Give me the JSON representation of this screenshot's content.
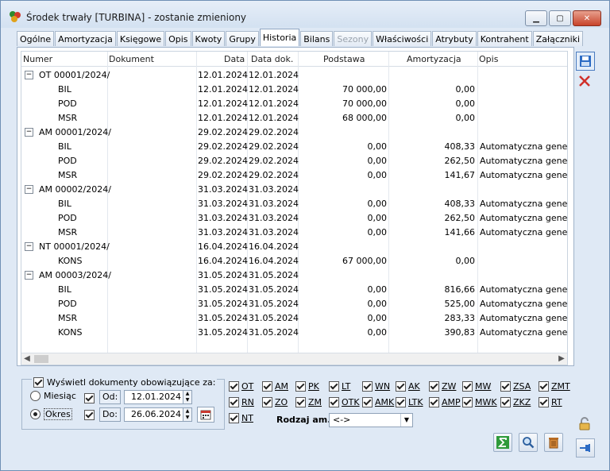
{
  "window": {
    "title": "Środek trwały [TURBINA] - zostanie zmieniony",
    "min_label": "▁",
    "max_label": "▢",
    "close_label": "✕"
  },
  "tabs": [
    {
      "label": "Ogólne"
    },
    {
      "label": "Amortyzacja"
    },
    {
      "label": "Księgowe"
    },
    {
      "label": "Opis"
    },
    {
      "label": "Kwoty"
    },
    {
      "label": "Grupy"
    },
    {
      "label": "Historia"
    },
    {
      "label": "Bilans"
    },
    {
      "label": "Sezony"
    },
    {
      "label": "Właściwości"
    },
    {
      "label": "Atrybuty"
    },
    {
      "label": "Kontrahent"
    },
    {
      "label": "Załączniki"
    }
  ],
  "active_tab": "Historia",
  "grid": {
    "headers": {
      "numer": "Numer",
      "dokument": "Dokument",
      "data": "Data",
      "data_dok": "Data dok.",
      "podstawa": "Podstawa",
      "amortyzacja": "Amortyzacja",
      "opis": "Opis"
    },
    "rows": [
      {
        "group": true,
        "toggle": "−",
        "numer": "OT  00001/2024/",
        "dokument": "",
        "data": "12.01.2024",
        "data_dok": "12.01.2024",
        "podstawa": "",
        "amortyzacja": "",
        "opis": ""
      },
      {
        "group": false,
        "numer": "BIL",
        "dokument": "",
        "data": "12.01.2024",
        "data_dok": "12.01.2024",
        "podstawa": "70 000,00",
        "amortyzacja": "0,00",
        "opis": ""
      },
      {
        "group": false,
        "numer": "POD",
        "dokument": "",
        "data": "12.01.2024",
        "data_dok": "12.01.2024",
        "podstawa": "70 000,00",
        "amortyzacja": "0,00",
        "opis": ""
      },
      {
        "group": false,
        "numer": "MSR",
        "dokument": "",
        "data": "12.01.2024",
        "data_dok": "12.01.2024",
        "podstawa": "68 000,00",
        "amortyzacja": "0,00",
        "opis": ""
      },
      {
        "group": true,
        "toggle": "−",
        "numer": "AM  00001/2024/",
        "dokument": "",
        "data": "29.02.2024",
        "data_dok": "29.02.2024",
        "podstawa": "",
        "amortyzacja": "",
        "opis": ""
      },
      {
        "group": false,
        "numer": "BIL",
        "dokument": "",
        "data": "29.02.2024",
        "data_dok": "29.02.2024",
        "podstawa": "0,00",
        "amortyzacja": "408,33",
        "opis": "Automatyczna generac"
      },
      {
        "group": false,
        "numer": "POD",
        "dokument": "",
        "data": "29.02.2024",
        "data_dok": "29.02.2024",
        "podstawa": "0,00",
        "amortyzacja": "262,50",
        "opis": "Automatyczna generac"
      },
      {
        "group": false,
        "numer": "MSR",
        "dokument": "",
        "data": "29.02.2024",
        "data_dok": "29.02.2024",
        "podstawa": "0,00",
        "amortyzacja": "141,67",
        "opis": "Automatyczna generac"
      },
      {
        "group": true,
        "toggle": "−",
        "numer": "AM  00002/2024/",
        "dokument": "",
        "data": "31.03.2024",
        "data_dok": "31.03.2024",
        "podstawa": "",
        "amortyzacja": "",
        "opis": ""
      },
      {
        "group": false,
        "numer": "BIL",
        "dokument": "",
        "data": "31.03.2024",
        "data_dok": "31.03.2024",
        "podstawa": "0,00",
        "amortyzacja": "408,33",
        "opis": "Automatyczna generac"
      },
      {
        "group": false,
        "numer": "POD",
        "dokument": "",
        "data": "31.03.2024",
        "data_dok": "31.03.2024",
        "podstawa": "0,00",
        "amortyzacja": "262,50",
        "opis": "Automatyczna generac"
      },
      {
        "group": false,
        "numer": "MSR",
        "dokument": "",
        "data": "31.03.2024",
        "data_dok": "31.03.2024",
        "podstawa": "0,00",
        "amortyzacja": "141,66",
        "opis": "Automatyczna generac"
      },
      {
        "group": true,
        "toggle": "−",
        "numer": "NT  00001/2024/",
        "dokument": "",
        "data": "16.04.2024",
        "data_dok": "16.04.2024",
        "podstawa": "",
        "amortyzacja": "",
        "opis": ""
      },
      {
        "group": false,
        "numer": "KONS",
        "dokument": "",
        "data": "16.04.2024",
        "data_dok": "16.04.2024",
        "podstawa": "67 000,00",
        "amortyzacja": "0,00",
        "opis": ""
      },
      {
        "group": true,
        "toggle": "−",
        "numer": "AM  00003/2024/",
        "dokument": "",
        "data": "31.05.2024",
        "data_dok": "31.05.2024",
        "podstawa": "",
        "amortyzacja": "",
        "opis": ""
      },
      {
        "group": false,
        "numer": "BIL",
        "dokument": "",
        "data": "31.05.2024",
        "data_dok": "31.05.2024",
        "podstawa": "0,00",
        "amortyzacja": "816,66",
        "opis": "Automatyczna generac"
      },
      {
        "group": false,
        "numer": "POD",
        "dokument": "",
        "data": "31.05.2024",
        "data_dok": "31.05.2024",
        "podstawa": "0,00",
        "amortyzacja": "525,00",
        "opis": "Automatyczna generac"
      },
      {
        "group": false,
        "numer": "MSR",
        "dokument": "",
        "data": "31.05.2024",
        "data_dok": "31.05.2024",
        "podstawa": "0,00",
        "amortyzacja": "283,33",
        "opis": "Automatyczna generac"
      },
      {
        "group": false,
        "numer": "KONS",
        "dokument": "",
        "data": "31.05.2024",
        "data_dok": "31.05.2024",
        "podstawa": "0,00",
        "amortyzacja": "390,83",
        "opis": "Automatyczna generac"
      }
    ],
    "scroll_left": "◀",
    "scroll_right": "▶"
  },
  "filter": {
    "show_docs_label": "Wyświetl dokumenty obowiązujące za:",
    "show_docs_checked": true,
    "miesiac_label": "Miesiąc",
    "okres_label": "Okres",
    "selected_period": "Okres",
    "od_label": "Od:",
    "od_value": "12.01.2024",
    "od_checked": true,
    "do_label": "Do:",
    "do_value": "26.06.2024",
    "do_checked": true,
    "spin_up": "▲",
    "spin_down": "▼"
  },
  "doc_types": [
    {
      "label": "OT",
      "checked": true
    },
    {
      "label": "AM",
      "checked": true
    },
    {
      "label": "PK",
      "checked": true
    },
    {
      "label": "LT",
      "checked": true
    },
    {
      "label": "WN",
      "checked": true
    },
    {
      "label": "AK",
      "checked": true
    },
    {
      "label": "ZW",
      "checked": true
    },
    {
      "label": "MW",
      "checked": true
    },
    {
      "label": "ZSA",
      "checked": true
    },
    {
      "label": "ZMT",
      "checked": true
    },
    {
      "label": "RN",
      "checked": true
    },
    {
      "label": "ZO",
      "checked": true
    },
    {
      "label": "ZM",
      "checked": true
    },
    {
      "label": "OTK",
      "checked": true
    },
    {
      "label": "AMK",
      "checked": true
    },
    {
      "label": "LTK",
      "checked": true
    },
    {
      "label": "AMP",
      "checked": true
    },
    {
      "label": "MWK",
      "checked": true
    },
    {
      "label": "ZKZ",
      "checked": true
    },
    {
      "label": "RT",
      "checked": true
    },
    {
      "label": "NT",
      "checked": true
    }
  ],
  "rodzaj_am": {
    "label": "Rodzaj am.:",
    "value": "<->",
    "dropdown_glyph": "▼"
  },
  "colors": {
    "accent": "#2c6bc4",
    "delete_red": "#d0302a",
    "sum_green": "#2e9a3a"
  }
}
